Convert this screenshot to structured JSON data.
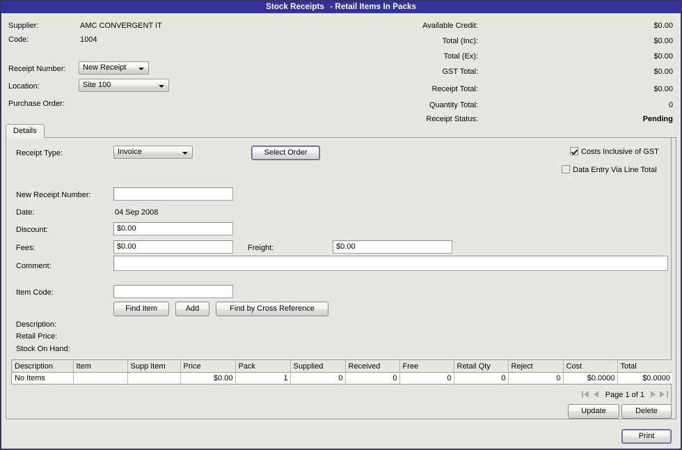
{
  "window": {
    "title_main": "Stock Receipts",
    "title_sub": "- Retail Items In Packs",
    "accent_color": "#333399",
    "background_color": "#e7e7e2"
  },
  "header": {
    "left_fields": [
      {
        "label": "Supplier:",
        "value": "AMC CONVERGENT IT"
      },
      {
        "label": "Code:",
        "value": "1004"
      }
    ],
    "receipt_number_label": "Receipt Number:",
    "receipt_number_value": "New Receipt",
    "location_label": "Location:",
    "location_value": "Site 100",
    "purchase_order_label": "Purchase Order:",
    "purchase_order_value": "",
    "summary": [
      {
        "label": "Available Credit:",
        "value": "$0.00",
        "bold": false
      },
      {
        "label": "Total (Inc):",
        "value": "$0.00",
        "bold": false
      },
      {
        "label": "Total (Ex):",
        "value": "$0.00",
        "bold": false
      },
      {
        "label": "GST Total:",
        "value": "$0.00",
        "bold": false
      },
      {
        "label": "Receipt Total:",
        "value": "$0.00",
        "bold": false
      },
      {
        "label": "Quantity Total:",
        "value": "0",
        "bold": false
      },
      {
        "label": "Receipt Status:",
        "value": "Pending",
        "bold": true
      }
    ]
  },
  "tabs": [
    {
      "label": "Details",
      "active": true
    }
  ],
  "details": {
    "receipt_type_label": "Receipt Type:",
    "receipt_type_value": "Invoice",
    "select_order_label": "Select Order",
    "costs_inclusive_label": "Costs Inclusive of GST",
    "costs_inclusive_checked": true,
    "data_entry_label": "Data Entry Via Line Total",
    "data_entry_checked": false,
    "new_receipt_number_label": "New Receipt Number:",
    "new_receipt_number_value": "",
    "new_receipt_number_placeholder": "",
    "date_label": "Date:",
    "date_value": "04 Sep 2008",
    "discount_label": "Discount:",
    "discount_value": "$0.00",
    "fees_label": "Fees:",
    "fees_value": "$0.00",
    "freight_label": "Freight:",
    "freight_value": "$0.00",
    "comment_label": "Comment:",
    "comment_value": "",
    "item_code_label": "Item Code:",
    "item_code_value": "",
    "find_item_label": "Find Item",
    "add_label": "Add",
    "find_cross_ref_label": "Find by Cross Reference",
    "description_label": "Description:",
    "description_value": "",
    "retail_price_label": "Retail Price:",
    "retail_price_value": "",
    "stock_on_hand_label": "Stock On Hand:",
    "stock_on_hand_value": ""
  },
  "grid": {
    "columns": [
      "Description",
      "Item",
      "Supp Item",
      "Price",
      "Pack",
      "Supplied",
      "Received",
      "Free",
      "Retail Qty",
      "Reject",
      "Cost",
      "Total"
    ],
    "rows": [
      {
        "Description": "No Items",
        "Item": "",
        "Supp Item": "",
        "Price": "$0.00",
        "Pack": "1",
        "Supplied": "0",
        "Received": "0",
        "Free": "0",
        "Retail Qty": "0",
        "Reject": "0",
        "Cost": "$0.0000",
        "Total": "$0.0000"
      }
    ]
  },
  "pager": {
    "first_icon": "first-page-icon",
    "prev_icon": "previous-page-icon",
    "text": "Page 1 of 1",
    "next_icon": "next-page-icon",
    "last_icon": "last-page-icon"
  },
  "actions": {
    "update_label": "Update",
    "delete_label": "Delete",
    "print_label": "Print"
  }
}
